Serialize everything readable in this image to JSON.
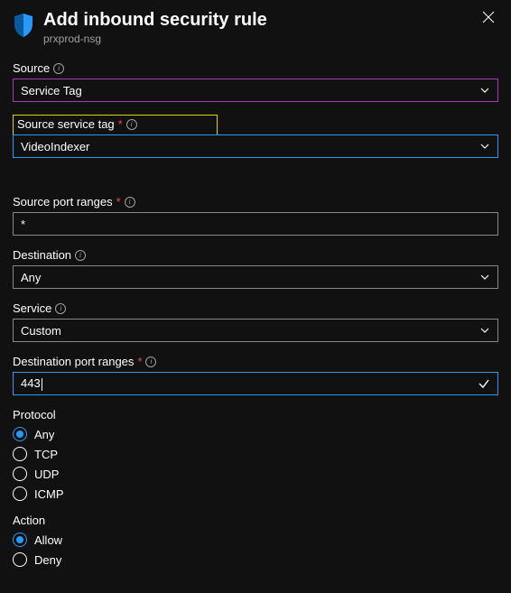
{
  "header": {
    "title": "Add inbound security rule",
    "subtitle": "prxprod-nsg"
  },
  "fields": {
    "source": {
      "label": "Source",
      "value": "Service Tag"
    },
    "source_service_tag": {
      "label": "Source service tag",
      "value": "VideoIndexer"
    },
    "source_port_ranges": {
      "label": "Source port ranges",
      "value": "*"
    },
    "destination": {
      "label": "Destination",
      "value": "Any"
    },
    "service": {
      "label": "Service",
      "value": "Custom"
    },
    "destination_port_ranges": {
      "label": "Destination port ranges",
      "value": "443"
    }
  },
  "protocol": {
    "label": "Protocol",
    "options": [
      "Any",
      "TCP",
      "UDP",
      "ICMP"
    ],
    "selected": "Any"
  },
  "action": {
    "label": "Action",
    "options": [
      "Allow",
      "Deny"
    ],
    "selected": "Allow"
  }
}
